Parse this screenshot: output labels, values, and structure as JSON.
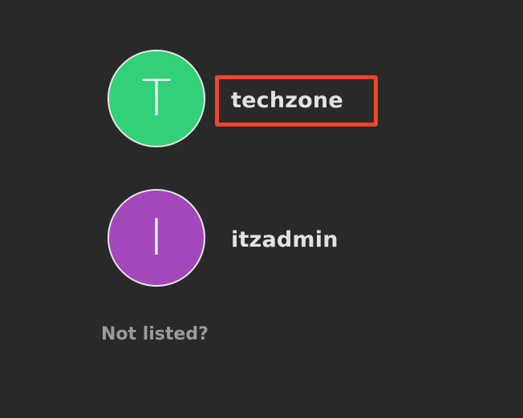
{
  "users": [
    {
      "initial": "T",
      "name": "techzone",
      "avatar_color": "#33d07a"
    },
    {
      "initial": "I",
      "name": "itzadmin",
      "avatar_color": "#a347ba"
    }
  ],
  "not_listed_label": "Not listed?",
  "highlight_color": "#f0442c"
}
